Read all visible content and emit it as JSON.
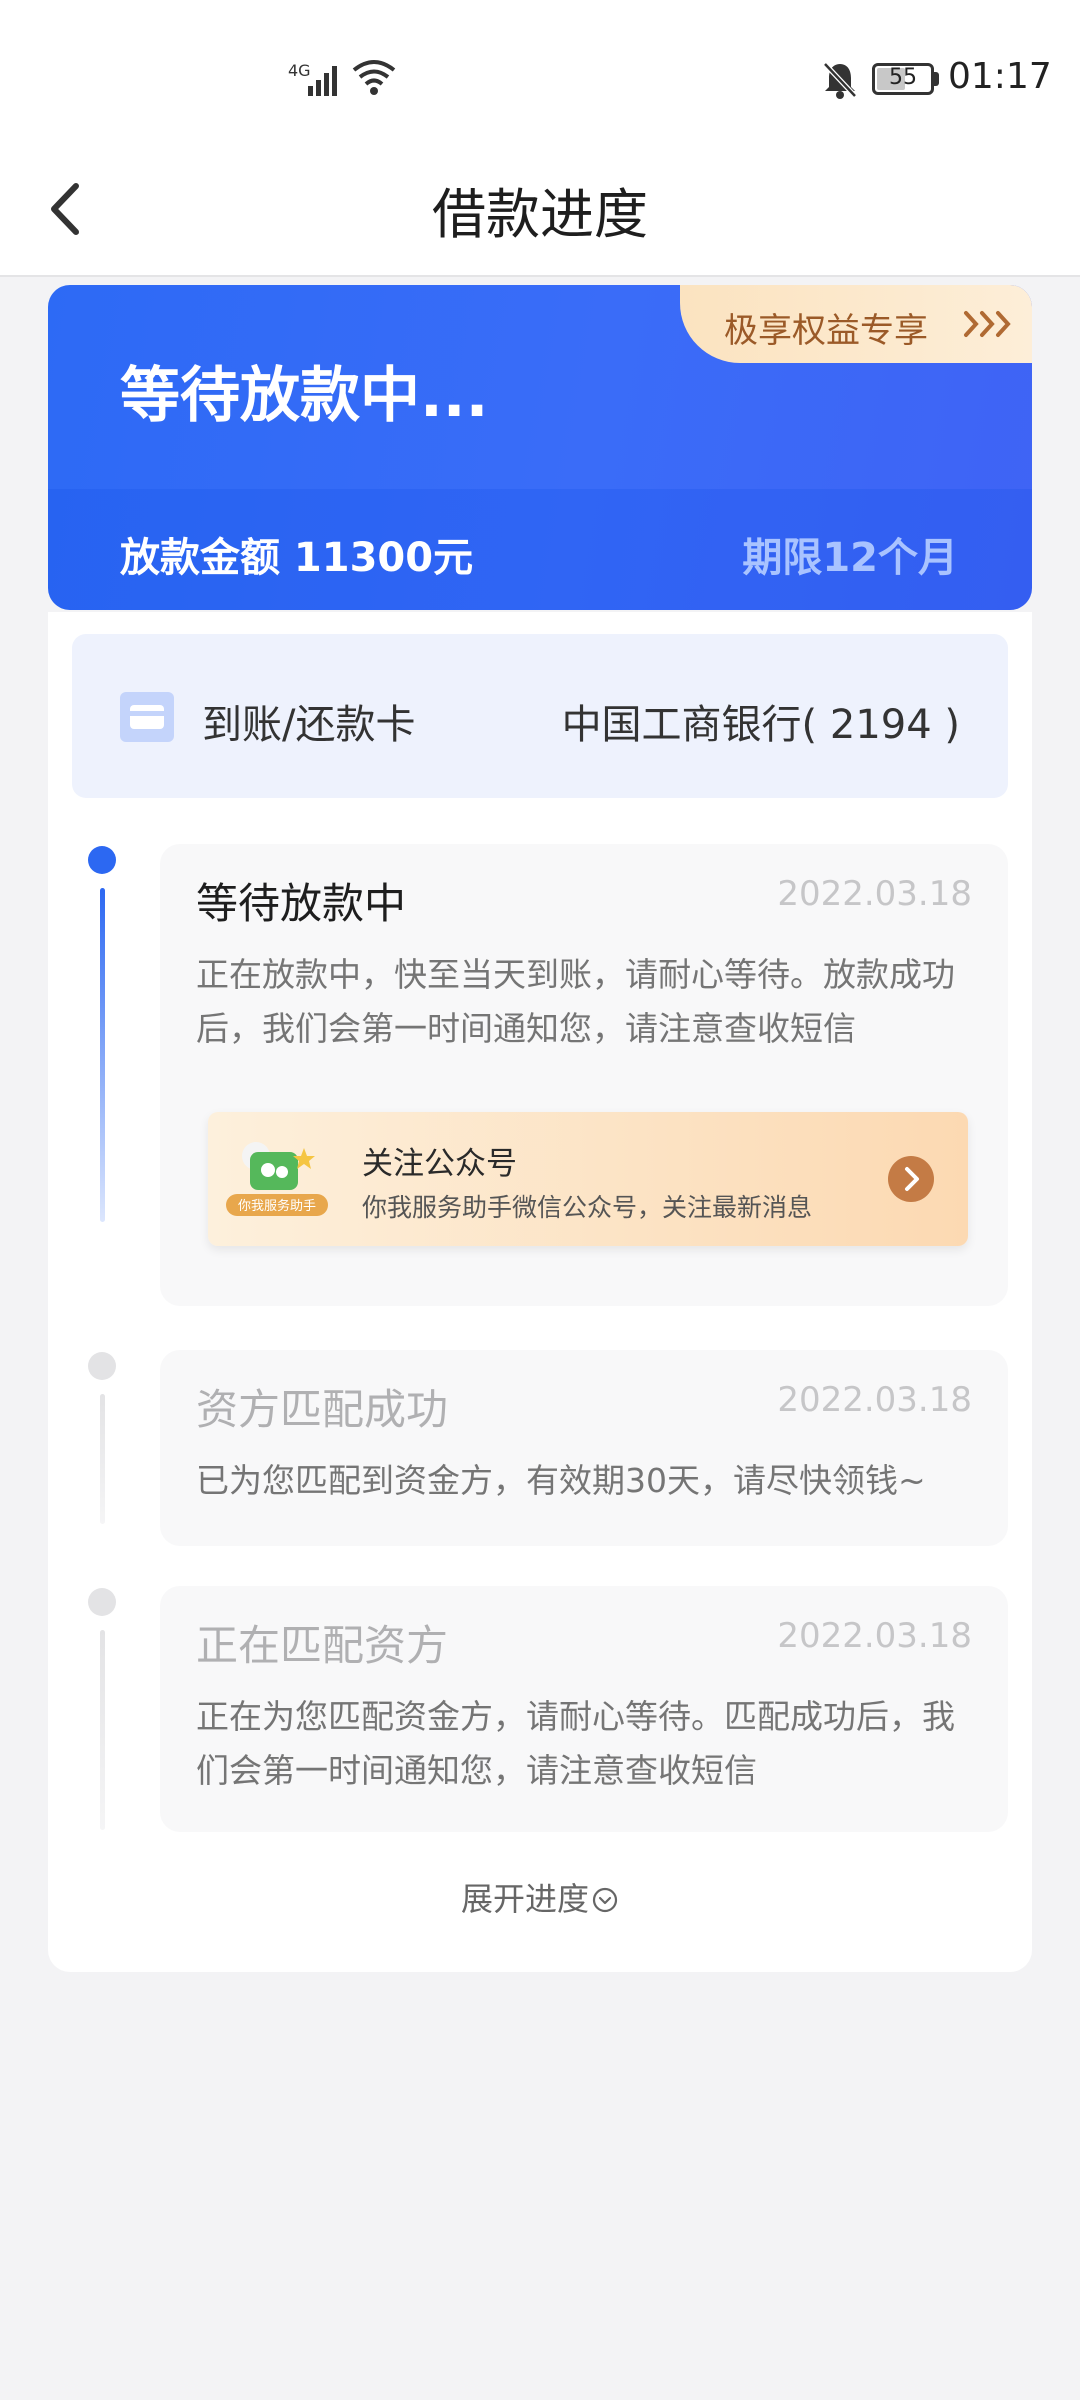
{
  "status_bar": {
    "network": "4G",
    "battery": "55",
    "time": "01:17",
    "icons": [
      "signal-icon",
      "wifi-icon",
      "bell-off-icon",
      "battery-icon"
    ]
  },
  "header": {
    "title": "借款进度",
    "back_icon": "chevron-left-icon"
  },
  "hero": {
    "status_title": "等待放款中...",
    "amount_text": "放款金额 11300元",
    "term_text": "期限12个月",
    "benefit_label": "极享权益专享",
    "colors": {
      "primary": "#2d6af5",
      "badge": "#fbe3c0",
      "badge_text": "#9b5a28"
    }
  },
  "bank": {
    "label": "到账/还款卡",
    "value": "中国工商银行( 2194 )",
    "icon": "bank-card-icon"
  },
  "steps": [
    {
      "title": "等待放款中",
      "date": "2022.03.18",
      "desc_line1": "正在放款中，快至当天到账，请耐心等待。放款成功",
      "desc_line2": "后，我们会第一时间通知您，请注意查收短信",
      "active": true
    },
    {
      "title": "资方匹配成功",
      "date": "2022.03.18",
      "desc_line1": "已为您匹配到资金方，有效期30天，请尽快领钱~",
      "active": false
    },
    {
      "title": "正在匹配资方",
      "date": "2022.03.18",
      "desc_line1": "正在为您匹配资金方，请耐心等待。匹配成功后，我",
      "desc_line2": "们会第一时间通知您，请注意查收短信",
      "active": false
    }
  ],
  "wechat_promo": {
    "title": "关注公众号",
    "subtitle": "你我服务助手微信公众号，关注最新消息",
    "badge": "你我服务助手",
    "icon": "wechat-icon"
  },
  "expand": {
    "label": "展开进度",
    "icon": "chevron-down-circle-icon"
  }
}
